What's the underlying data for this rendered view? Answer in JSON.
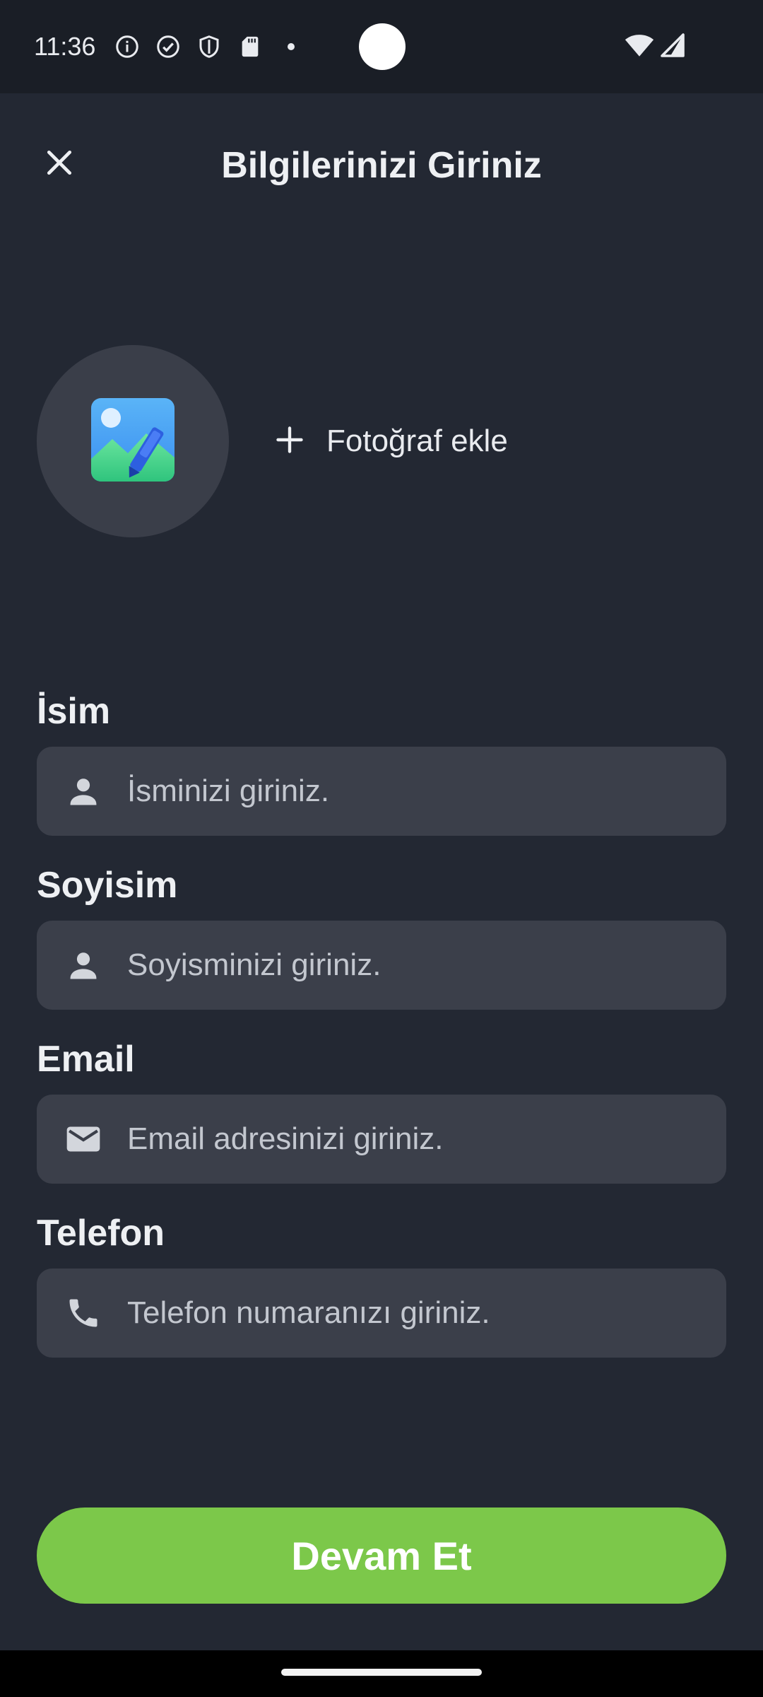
{
  "status_bar": {
    "time": "11:36",
    "left_icons": [
      "info-icon",
      "check-circle-icon",
      "shield-icon",
      "sd-card-icon",
      "dot-icon"
    ],
    "right_icons": [
      "wifi-icon",
      "signal-icon"
    ]
  },
  "header": {
    "title": "Bilgilerinizi Giriniz",
    "close_icon": "close-icon"
  },
  "photo": {
    "placeholder_icon": "image-edit-icon",
    "add_label": "Fotoğraf ekle",
    "add_icon": "plus-icon"
  },
  "form": {
    "name": {
      "label": "İsim",
      "placeholder": "İsminizi giriniz.",
      "value": "",
      "icon": "person-icon"
    },
    "surname": {
      "label": "Soyisim",
      "placeholder": "Soyisminizi giriniz.",
      "value": "",
      "icon": "person-icon"
    },
    "email": {
      "label": "Email",
      "placeholder": "Email adresinizi giriniz.",
      "value": "",
      "icon": "mail-icon"
    },
    "phone": {
      "label": "Telefon",
      "placeholder": "Telefon numaranızı giriniz.",
      "value": "",
      "icon": "phone-icon"
    }
  },
  "continue_button": {
    "label": "Devam Et"
  },
  "colors": {
    "background": "#232833",
    "status_bar": "#1a1e26",
    "field_background": "#3b3f4a",
    "accent_green": "#7cc84a",
    "text_primary": "#eef0f3"
  }
}
